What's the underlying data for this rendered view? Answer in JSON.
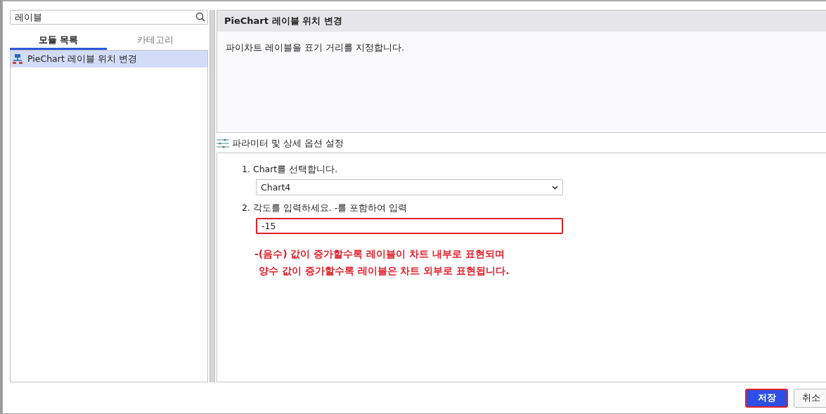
{
  "search": {
    "value": "레이블"
  },
  "tabs": [
    {
      "label": "모듈 목록",
      "selected": true
    },
    {
      "label": "카테고리",
      "selected": false
    }
  ],
  "modules": [
    {
      "label": "PieChart 레이블 위치 변경",
      "selected": true
    }
  ],
  "detail": {
    "title": "PieChart 레이블 위치 변경",
    "description": "파이차트 레이블을 표기 거리를 지정합니다."
  },
  "params": {
    "header": "파라미터 및 상세 옵션 설정",
    "fields": [
      {
        "kind": "select",
        "label": "1. Chart를 선택합니다.",
        "value": "Chart4",
        "highlighted": false
      },
      {
        "kind": "text",
        "label": "2. 각도를 입력하세요. -를 포함하여 입력",
        "value": "-15",
        "highlighted": true
      }
    ],
    "notes": [
      "-(음수) 값이 증가할수록 레이블이 차트 내부로 표현되며",
      "양수 값이 증가할수록 레이블은 차트 외부로 표현됩니다."
    ]
  },
  "buttons": [
    {
      "label": "저장",
      "primary": true
    },
    {
      "label": "취소",
      "primary": false
    }
  ]
}
